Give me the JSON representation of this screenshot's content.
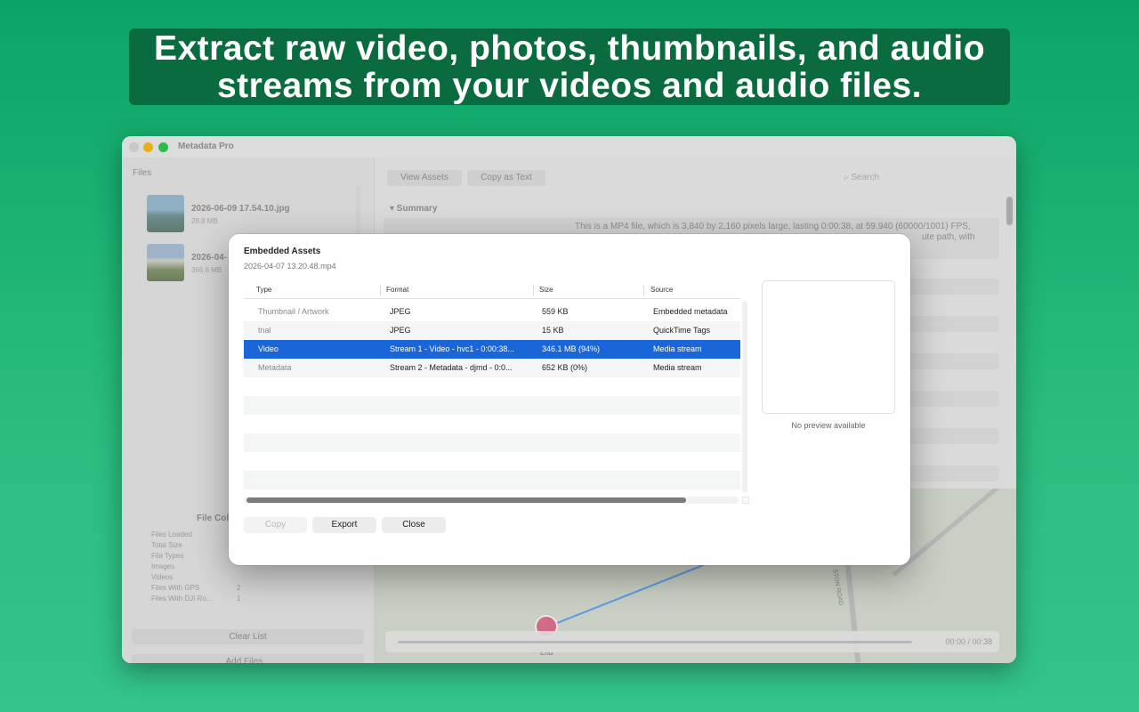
{
  "banner": {
    "line1": "Extract raw video, photos, thumbnails, and audio",
    "line2": "streams from your videos and audio files."
  },
  "window": {
    "title": "Metadata Pro"
  },
  "sidebar": {
    "files_label": "Files",
    "files": [
      {
        "name": "2026-06-09 17.54.10.jpg",
        "size": "28.8 MB"
      },
      {
        "name": "2026-04-",
        "size": "366.6 MB"
      }
    ],
    "stats_title": "File Col",
    "stats": [
      {
        "label": "Files Loaded",
        "value": ""
      },
      {
        "label": "Total Size",
        "value": ""
      },
      {
        "label": "File Types",
        "value": ""
      },
      {
        "label": "Images",
        "value": ""
      },
      {
        "label": "Videos",
        "value": ""
      },
      {
        "label": "Files With GPS",
        "value": "2"
      },
      {
        "label": "Files With DJI Ro...",
        "value": "1"
      }
    ],
    "clear_button": "Clear List",
    "add_button": "Add Files..."
  },
  "content": {
    "view_assets_button": "View Assets",
    "copy_text_button": "Copy as Text",
    "search_placeholder": "Search",
    "summary_label": "▾ Summary",
    "summary_text": "This is a MP4 file, which is 3,840 by 2,160 pixels large, lasting 0:00:38, at 59.940 (60000/1001) FPS,",
    "summary_text2": "ute path, with",
    "map_end_label": "End",
    "road_label": "STON ROAD",
    "time": "00:00 / 00:38"
  },
  "dialog": {
    "title": "Embedded Assets",
    "subtitle": "2026-04-07 13.20.48.mp4",
    "columns": [
      "Type",
      "Format",
      "Size",
      "Source"
    ],
    "rows": [
      {
        "type": "Thumbnail / Artwork",
        "format": "JPEG",
        "size": "559 KB",
        "source": "Embedded metadata"
      },
      {
        "type": "tnal",
        "format": "JPEG",
        "size": "15 KB",
        "source": "QuickTime Tags"
      },
      {
        "type": "Video",
        "format": "Stream 1 - Video - hvc1 - 0:00:38...",
        "size": "346.1 MB (94%)",
        "source": "Media stream"
      },
      {
        "type": "Metadata",
        "format": "Stream 2 - Metadata - djmd - 0:0...",
        "size": "652 KB (0%)",
        "source": "Media stream"
      }
    ],
    "preview_label": "No preview available",
    "copy_button": "Copy",
    "export_button": "Export",
    "close_button": "Close"
  }
}
